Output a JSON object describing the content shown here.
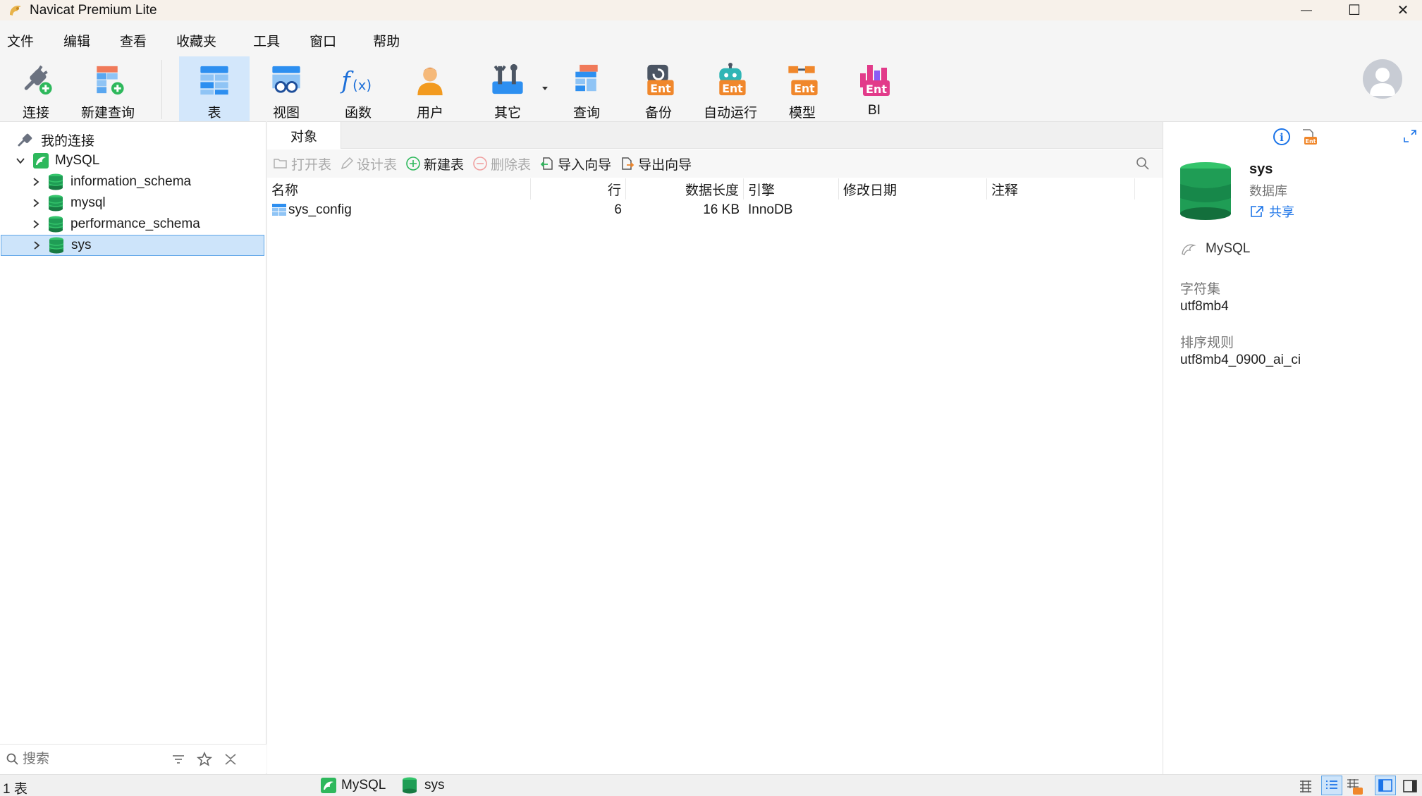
{
  "window": {
    "title": "Navicat Premium Lite",
    "minimize_glyph": "—",
    "maximize_glyph": "☐",
    "close_glyph": "✕"
  },
  "menu": [
    "文件",
    "编辑",
    "查看",
    "收藏夹",
    "工具",
    "窗口",
    "帮助"
  ],
  "toolbar": {
    "connect": "连接",
    "new_query": "新建查询",
    "table": "表",
    "view": "视图",
    "function": "函数",
    "user": "用户",
    "other": "其它",
    "query": "查询",
    "backup": "备份",
    "automation": "自动运行",
    "model": "模型",
    "bi": "BI",
    "ent_badge": "Ent"
  },
  "tree": {
    "root": "我的连接",
    "connection": "MySQL",
    "databases": [
      "information_schema",
      "mysql",
      "performance_schema",
      "sys"
    ],
    "selected": "sys",
    "search_placeholder": "搜索"
  },
  "objects": {
    "tab": "对象",
    "actions": {
      "open_table": "打开表",
      "design_table": "设计表",
      "new_table": "新建表",
      "delete_table": "删除表",
      "import_wizard": "导入向导",
      "export_wizard": "导出向导"
    },
    "columns": [
      "名称",
      "行",
      "数据长度",
      "引擎",
      "修改日期",
      "注释"
    ],
    "rows": [
      {
        "name": "sys_config",
        "rows": "6",
        "data_length": "16 KB",
        "engine": "InnoDB",
        "modified": "",
        "comment": ""
      }
    ]
  },
  "info": {
    "db_name": "sys",
    "db_type": "数据库",
    "share": "共享",
    "connection": "MySQL",
    "charset_label": "字符集",
    "charset_value": "utf8mb4",
    "collation_label": "排序规则",
    "collation_value": "utf8mb4_0900_ai_ci",
    "info_glyph": "i",
    "ent_badge": "Ent"
  },
  "status": {
    "count": "1 表",
    "connection": "MySQL",
    "database": "sys"
  },
  "colors": {
    "accent": "#1a73e8",
    "selected_bg": "#cde4fa",
    "db_green": "#1f9d55",
    "ent_orange": "#f0872b"
  }
}
